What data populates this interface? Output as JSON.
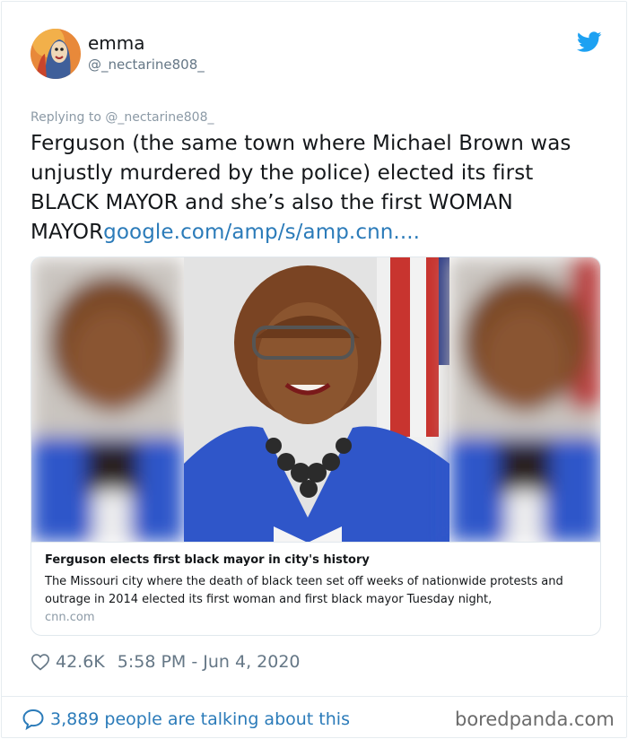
{
  "author": {
    "display_name": "emma",
    "handle": "@_nectarine808_"
  },
  "tweet": {
    "replying_to": "Replying to @_nectarine808_",
    "text": "Ferguson (the same town where Michael Brown was unjustly murdered by the police) elected its first BLACK MAYOR and she’s also the first WOMAN MAYOR",
    "link_text": "google.com/amp/s/amp.cnn...."
  },
  "link_card": {
    "title": "Ferguson elects first black mayor in city's history",
    "description": "The Missouri city where the death of black teen set off weeks of nationwide protests and outrage in 2014 elected its first woman and first black mayor Tuesday night,",
    "domain": "cnn.com"
  },
  "meta": {
    "likes": "42.6K",
    "timestamp": "5:58 PM - Jun 4, 2020"
  },
  "conversation": {
    "label": "3,889 people are talking about this"
  },
  "watermark": "boredpanda.com",
  "icons": {
    "brand": "twitter-bird-icon",
    "like": "heart-icon",
    "reply": "speech-bubble-icon"
  },
  "colors": {
    "twitter_blue": "#1da1f2",
    "link_blue": "#2b7bb9",
    "muted_gray": "#657786",
    "jacket_blue": "#2f56c9"
  }
}
